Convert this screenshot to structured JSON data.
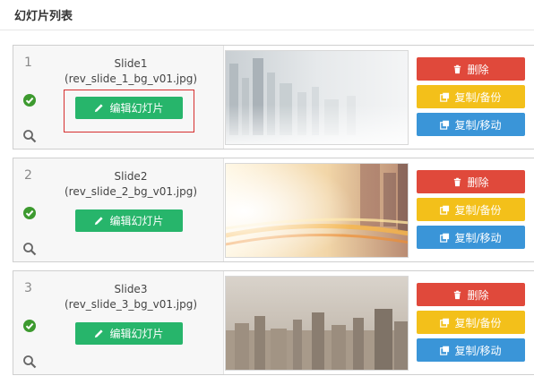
{
  "page": {
    "title": "幻灯片列表"
  },
  "slides": [
    {
      "number": "1",
      "title": "Slide1",
      "file": "(rev_slide_1_bg_v01.jpg)",
      "edit_label": "编辑幻灯片",
      "delete_label": "删除",
      "copy_label": "复制/备份",
      "move_label": "复制/移动",
      "highlighted": true
    },
    {
      "number": "2",
      "title": "Slide2",
      "file": "(rev_slide_2_bg_v01.jpg)",
      "edit_label": "编辑幻灯片",
      "delete_label": "删除",
      "copy_label": "复制/备份",
      "move_label": "复制/移动",
      "highlighted": false
    },
    {
      "number": "3",
      "title": "Slide3",
      "file": "(rev_slide_3_bg_v01.jpg)",
      "edit_label": "编辑幻灯片",
      "delete_label": "删除",
      "copy_label": "复制/备份",
      "move_label": "复制/移动",
      "highlighted": false
    }
  ],
  "icons": {
    "status": "check-circle-icon",
    "preview": "search-icon",
    "edit": "pencil-icon",
    "delete": "trash-icon",
    "copy": "copy-icon"
  },
  "colors": {
    "edit": "#27b56b",
    "delete": "#e0493b",
    "copy": "#f3c01a",
    "move": "#3a95d8",
    "status": "#3d9a2f",
    "highlight": "#d62f2f"
  }
}
